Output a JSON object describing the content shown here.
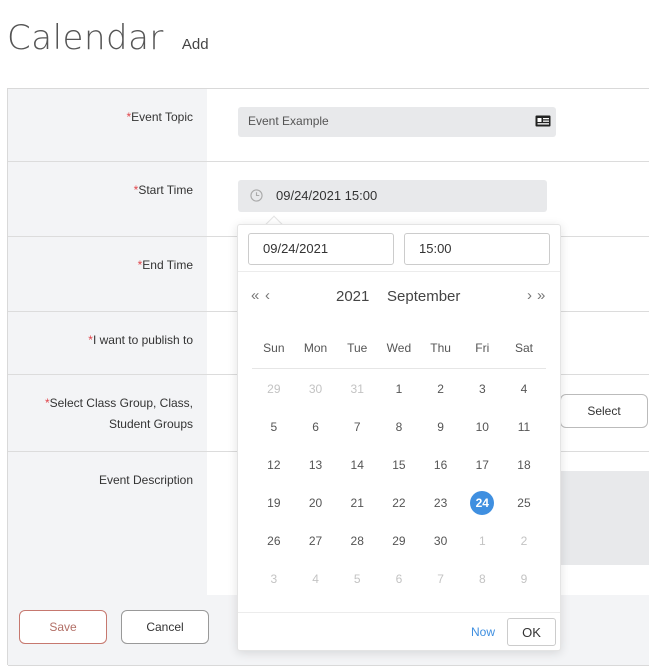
{
  "header": {
    "title": "Calendar",
    "subtitle": "Add"
  },
  "form": {
    "event_topic": {
      "label": "Event Topic",
      "value": "Event Example",
      "icon": "id-card-icon"
    },
    "start_time": {
      "label": "Start Time",
      "value": "09/24/2021 15:00",
      "icon": "clock-icon"
    },
    "end_time": {
      "label": "End Time"
    },
    "publish_to": {
      "label": "I want to publish to"
    },
    "class_group": {
      "label_line1": "Select Class Group, Class,",
      "label_line2": "Student Groups",
      "button": "Select"
    },
    "description": {
      "label": "Event Description"
    },
    "required_mark": "*"
  },
  "footer": {
    "save": "Save",
    "cancel": "Cancel"
  },
  "picker": {
    "date_value": "09/24/2021",
    "time_value": "15:00",
    "year": "2021",
    "month": "September",
    "prev_year": "«",
    "prev_month": "‹",
    "next_month": "›",
    "next_year": "»",
    "weekdays": [
      "Sun",
      "Mon",
      "Tue",
      "Wed",
      "Thu",
      "Fri",
      "Sat"
    ],
    "weeks": [
      [
        {
          "d": "29",
          "m": true
        },
        {
          "d": "30",
          "m": true
        },
        {
          "d": "31",
          "m": true
        },
        {
          "d": "1"
        },
        {
          "d": "2"
        },
        {
          "d": "3"
        },
        {
          "d": "4"
        }
      ],
      [
        {
          "d": "5"
        },
        {
          "d": "6"
        },
        {
          "d": "7"
        },
        {
          "d": "8"
        },
        {
          "d": "9"
        },
        {
          "d": "10"
        },
        {
          "d": "11"
        }
      ],
      [
        {
          "d": "12"
        },
        {
          "d": "13"
        },
        {
          "d": "14"
        },
        {
          "d": "15"
        },
        {
          "d": "16"
        },
        {
          "d": "17"
        },
        {
          "d": "18"
        }
      ],
      [
        {
          "d": "19"
        },
        {
          "d": "20"
        },
        {
          "d": "21"
        },
        {
          "d": "22"
        },
        {
          "d": "23"
        },
        {
          "d": "24",
          "sel": true
        },
        {
          "d": "25"
        }
      ],
      [
        {
          "d": "26"
        },
        {
          "d": "27"
        },
        {
          "d": "28"
        },
        {
          "d": "29"
        },
        {
          "d": "30"
        },
        {
          "d": "1",
          "m": true
        },
        {
          "d": "2",
          "m": true
        }
      ],
      [
        {
          "d": "3",
          "m": true
        },
        {
          "d": "4",
          "m": true
        },
        {
          "d": "5",
          "m": true
        },
        {
          "d": "6",
          "m": true
        },
        {
          "d": "7",
          "m": true
        },
        {
          "d": "8",
          "m": true
        },
        {
          "d": "9",
          "m": true
        }
      ]
    ],
    "now_label": "Now",
    "ok_label": "OK"
  },
  "colors": {
    "accent": "#3f8fe0",
    "required": "#e0454b",
    "label_bg": "#f3f4f6",
    "save_border": "#c6786f"
  }
}
